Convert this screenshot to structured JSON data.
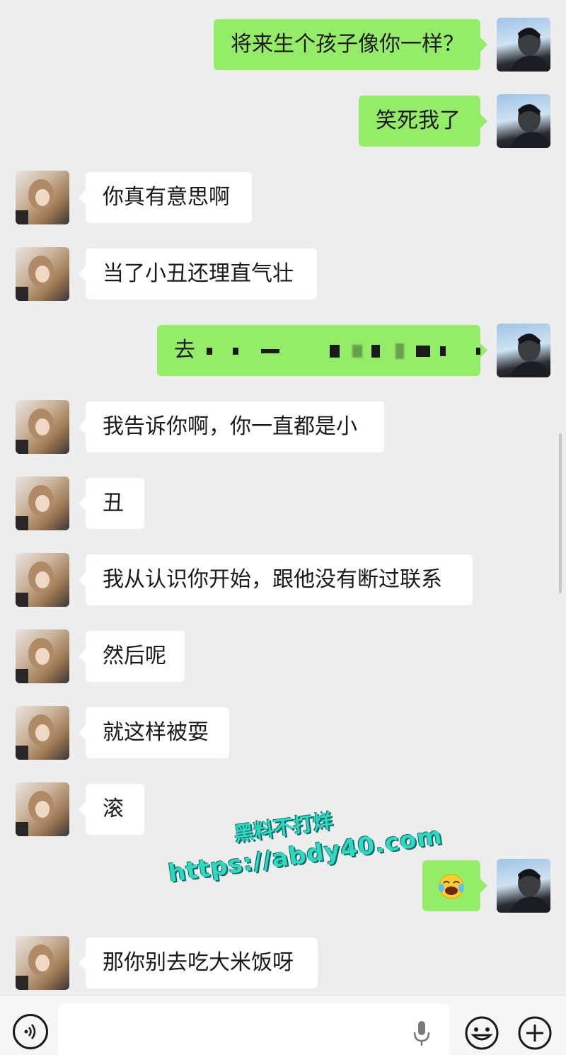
{
  "messages": [
    {
      "side": "right",
      "text": "将来生个孩子像你一样？"
    },
    {
      "side": "right",
      "text": "笑死我了"
    },
    {
      "side": "left",
      "text": "你真有意思啊"
    },
    {
      "side": "left",
      "text": "当了小丑还理直气壮"
    },
    {
      "side": "right",
      "text": "去",
      "redacted": true
    },
    {
      "side": "left",
      "text": "我告诉你啊，你一直都是小"
    },
    {
      "side": "left",
      "text": "丑"
    },
    {
      "side": "left",
      "text": "我从认识你开始，跟他没有断过联系"
    },
    {
      "side": "left",
      "text": "然后呢"
    },
    {
      "side": "left",
      "text": "就这样被耍"
    },
    {
      "side": "left",
      "text": "滚"
    },
    {
      "side": "right",
      "text": "😭",
      "emoji": "crying-laughing-face"
    },
    {
      "side": "left",
      "text": "那你别去吃大米饭呀"
    }
  ],
  "watermark": {
    "line1": "黑料不打烊",
    "line2": "https://abdy40.com"
  },
  "input_bar": {
    "voice_icon": "voice-icon",
    "mic_icon": "microphone-icon",
    "emoji_icon": "emoji-icon",
    "plus_icon": "plus-icon"
  },
  "colors": {
    "sent_bubble": "#95ec69",
    "received_bubble": "#ffffff",
    "background": "#ededed",
    "watermark": "#2fd8bf"
  }
}
